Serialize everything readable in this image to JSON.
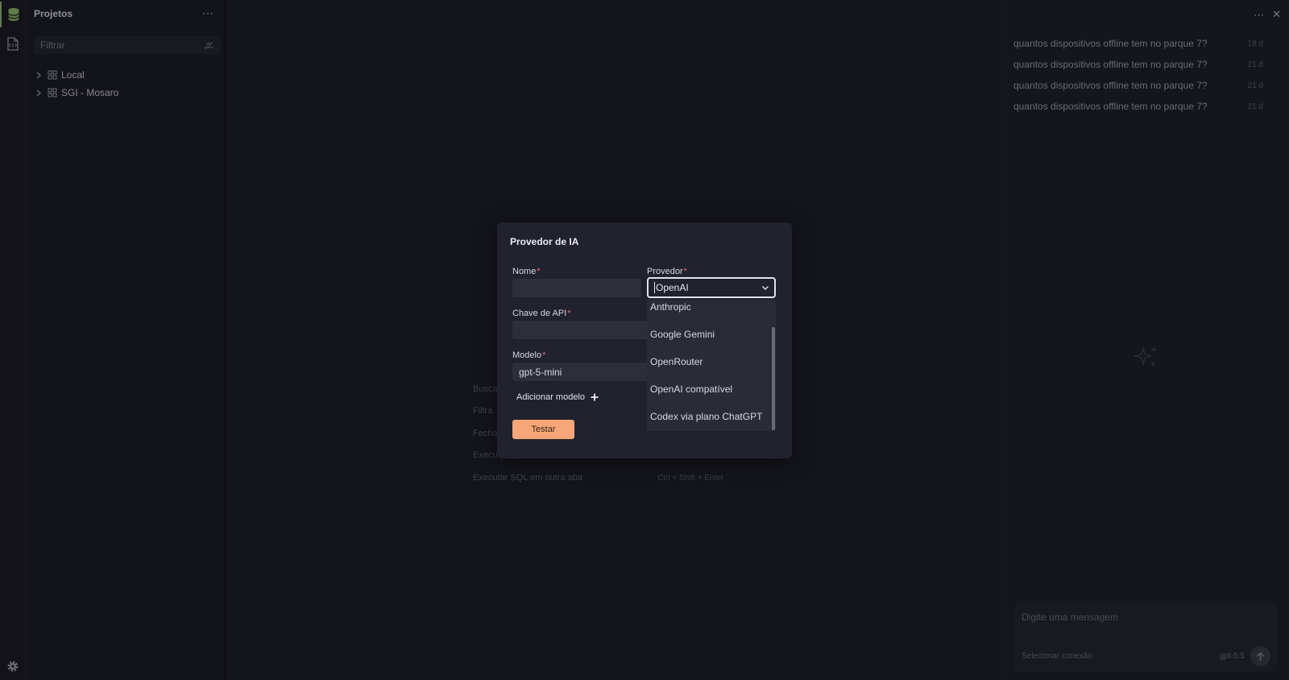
{
  "sidebar": {
    "title": "Projetos",
    "more_label": "⋯",
    "filter_placeholder": "Filtrar",
    "items": [
      {
        "label": "Local",
        "icon": "grid-icon"
      },
      {
        "label": "SGI - Mosaro",
        "icon": "grid-icon"
      }
    ]
  },
  "activity": {
    "icons": [
      "database-icon",
      "sql-file-icon",
      "gear-icon"
    ],
    "accent": "#8fb86a"
  },
  "main": {
    "shortcuts": [
      {
        "label": "Busca",
        "keys": ""
      },
      {
        "label": "Filtra",
        "keys": ""
      },
      {
        "label": "Fecha",
        "keys": ""
      },
      {
        "label": "Execu",
        "keys": ""
      },
      {
        "label": "Executar SQL em outra aba",
        "keys": "Ctrl  +  Shift  +  Enter"
      }
    ]
  },
  "ai_panel": {
    "more_label": "⋯",
    "close_label": "✕",
    "history": [
      {
        "question": "quantos dispositivos offline tem no parque 7?",
        "age": "18 d"
      },
      {
        "question": "quantos dispositivos offline tem no parque 7?",
        "age": "21 d"
      },
      {
        "question": "quantos dispositivos offline tem no parque 7?",
        "age": "21 d"
      },
      {
        "question": "quantos dispositivos offline tem no parque 7?",
        "age": "21 d"
      }
    ],
    "composer": {
      "placeholder": "Digite uma mensagem",
      "connection": "Selecionar conexão",
      "model": "gpt-5.5"
    }
  },
  "modal": {
    "title": "Provedor de IA",
    "required_mark": "*",
    "fields": {
      "name_label": "Nome",
      "name_value": "",
      "provider_label": "Provedor",
      "provider_value": "OpenAI",
      "api_key_label": "Chave de API",
      "api_key_value": "",
      "model_label": "Modelo",
      "model_value": "gpt-5-mini"
    },
    "add_model_label": "Adicionar modelo",
    "test_label": "Testar",
    "provider_options": [
      "Anthropic",
      "Google Gemini",
      "OpenRouter",
      "OpenAI compatível",
      "Codex via plano ChatGPT"
    ],
    "accent": "#f6a678"
  }
}
